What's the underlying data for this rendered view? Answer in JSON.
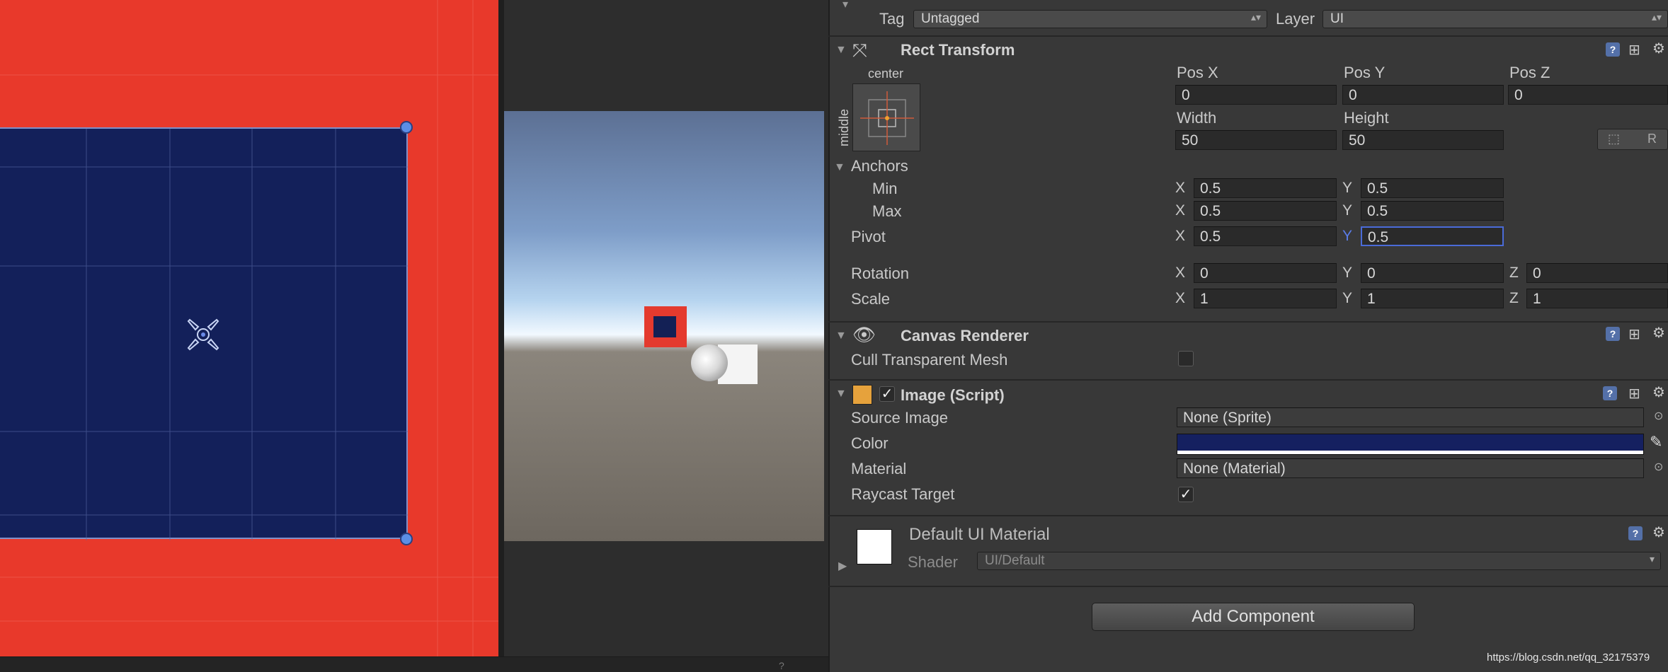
{
  "scene_view": {
    "icons": [
      "pivot-gizmo-icon",
      "corner-handle-icon"
    ]
  },
  "game_view": {},
  "status_bar": {
    "text": "?"
  },
  "inspector": {
    "tag": {
      "label": "Tag",
      "value": "Untagged"
    },
    "layer": {
      "label": "Layer",
      "value": "UI"
    },
    "rect_transform": {
      "title": "Rect Transform",
      "anchor_preset_h": "center",
      "anchor_preset_v": "middle",
      "pos_x_label": "Pos X",
      "pos_y_label": "Pos Y",
      "pos_z_label": "Pos Z",
      "pos_x": "0",
      "pos_y": "0",
      "pos_z": "0",
      "width_label": "Width",
      "height_label": "Height",
      "width": "50",
      "height": "50",
      "blueprint_r": "R",
      "anchors_label": "Anchors",
      "min_label": "Min",
      "max_label": "Max",
      "min_x": "0.5",
      "min_y": "0.5",
      "max_x": "0.5",
      "max_y": "0.5",
      "pivot_label": "Pivot",
      "pivot_x": "0.5",
      "pivot_y": "0.5",
      "rotation_label": "Rotation",
      "rot_x": "0",
      "rot_y": "0",
      "rot_z": "0",
      "scale_label": "Scale",
      "scale_x": "1",
      "scale_y": "1",
      "scale_z": "1",
      "axis_x": "X",
      "axis_y": "Y",
      "axis_z": "Z"
    },
    "canvas_renderer": {
      "title": "Canvas Renderer",
      "cull_label": "Cull Transparent Mesh",
      "cull_checked": false
    },
    "image_script": {
      "title": "Image (Script)",
      "enabled": true,
      "source_image_label": "Source Image",
      "source_image_value": "None (Sprite)",
      "color_label": "Color",
      "color_value": "#152060",
      "material_label": "Material",
      "material_value": "None (Material)",
      "raycast_label": "Raycast Target",
      "raycast_checked": true
    },
    "material": {
      "title": "Default UI Material",
      "shader_label": "Shader",
      "shader_value": "UI/Default"
    },
    "add_component": "Add Component"
  },
  "watermark": "https://blog.csdn.net/qq_32175379",
  "colors": {
    "scene_bg": "#e8392b",
    "rect_fill": "#13205a",
    "inspector_bg": "#383838",
    "accent_focus": "#4a6bd8"
  }
}
